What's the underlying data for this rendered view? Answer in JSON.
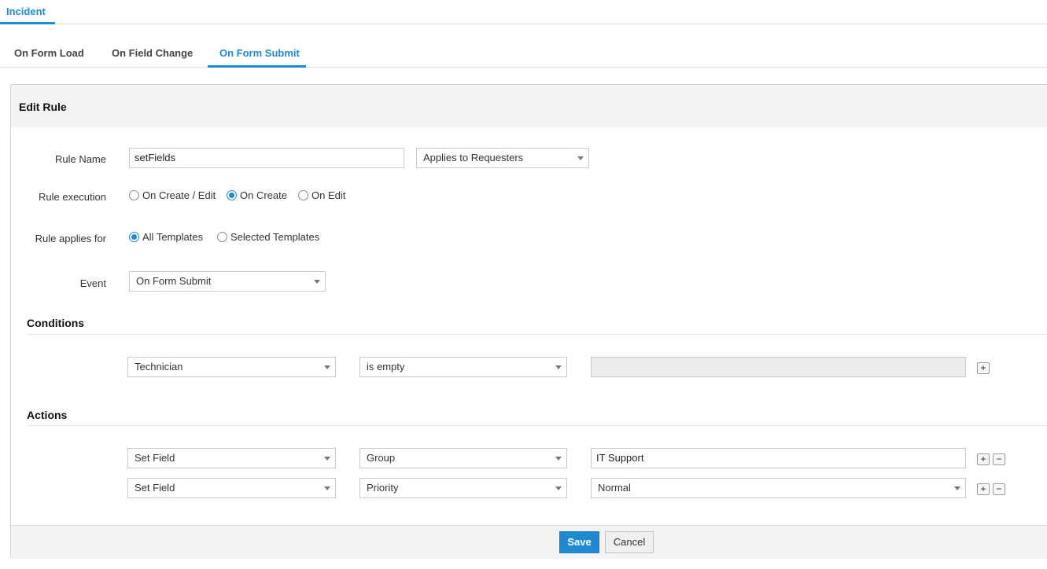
{
  "module_tab": {
    "label": "Incident"
  },
  "subtabs": [
    {
      "label": "On Form Load"
    },
    {
      "label": "On Field Change"
    },
    {
      "label": "On Form Submit",
      "active": true
    }
  ],
  "panel": {
    "title": "Edit Rule"
  },
  "form": {
    "rule_name": {
      "label": "Rule Name",
      "value": "setFields"
    },
    "applies_to": {
      "value": "Applies to Requesters"
    },
    "rule_execution": {
      "label": "Rule execution",
      "options": [
        "On Create / Edit",
        "On Create",
        "On Edit"
      ],
      "selected": "On Create"
    },
    "rule_applies_for": {
      "label": "Rule applies for",
      "options": [
        "All Templates",
        "Selected Templates"
      ],
      "selected": "All Templates"
    },
    "event": {
      "label": "Event",
      "value": "On Form Submit"
    }
  },
  "conditions": {
    "title": "Conditions",
    "rows": [
      {
        "field": "Technician",
        "operator": "is empty",
        "value": ""
      }
    ],
    "add_symbol": "+"
  },
  "actions": {
    "title": "Actions",
    "rows": [
      {
        "action": "Set Field",
        "field": "Group",
        "value": "IT Support"
      },
      {
        "action": "Set Field",
        "field": "Priority",
        "value": "Normal"
      }
    ],
    "add_symbol": "+",
    "remove_symbol": "−"
  },
  "footer": {
    "save_label": "Save",
    "cancel_label": "Cancel"
  },
  "colors": {
    "accent": "#1f8ad3",
    "header_bg": "#f3f3f3"
  }
}
